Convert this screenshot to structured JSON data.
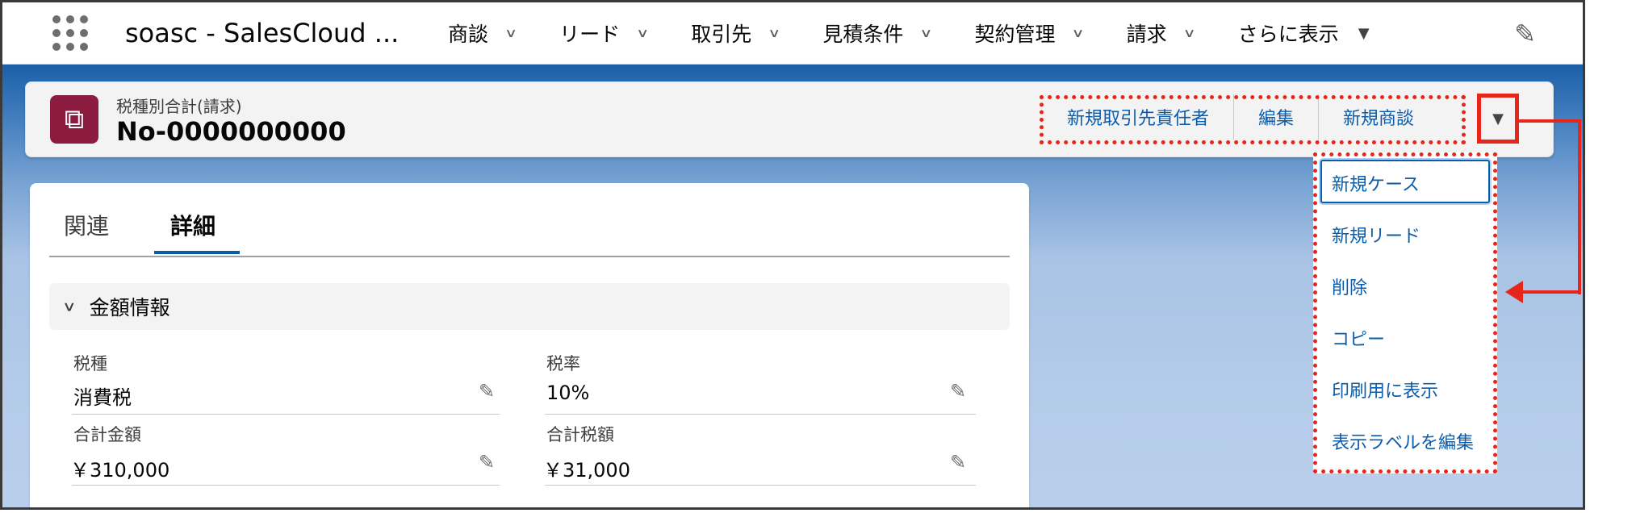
{
  "app": {
    "name": "soasc - SalesCloud ..."
  },
  "nav": {
    "items": [
      "商談",
      "リード",
      "取引先",
      "見積条件",
      "契約管理",
      "請求"
    ],
    "more_label": "さらに表示",
    "icons": {
      "launcher": "app-launcher-icon",
      "edit": "pencil-icon",
      "chevron": "chevron-down-icon"
    }
  },
  "record": {
    "object_type": "税種別合計(請求)",
    "name": "No-0000000000"
  },
  "actions": {
    "buttons": [
      "新規取引先責任者",
      "編集",
      "新規商談"
    ],
    "menu_items": [
      "新規ケース",
      "新規リード",
      "削除",
      "コピー",
      "印刷用に表示",
      "表示ラベルを編集"
    ]
  },
  "tabs": [
    "関連",
    "詳細"
  ],
  "section": {
    "title": "金額情報"
  },
  "fields": [
    {
      "label": "税種",
      "value": "消費税"
    },
    {
      "label": "税率",
      "value": "10%"
    },
    {
      "label": "合計金額",
      "value": "￥310,000"
    },
    {
      "label": "合計税額",
      "value": "￥31,000"
    }
  ],
  "colors": {
    "accent": "#0b5cab",
    "highlight": "#e8251a",
    "object_icon": "#8c1c3f"
  }
}
